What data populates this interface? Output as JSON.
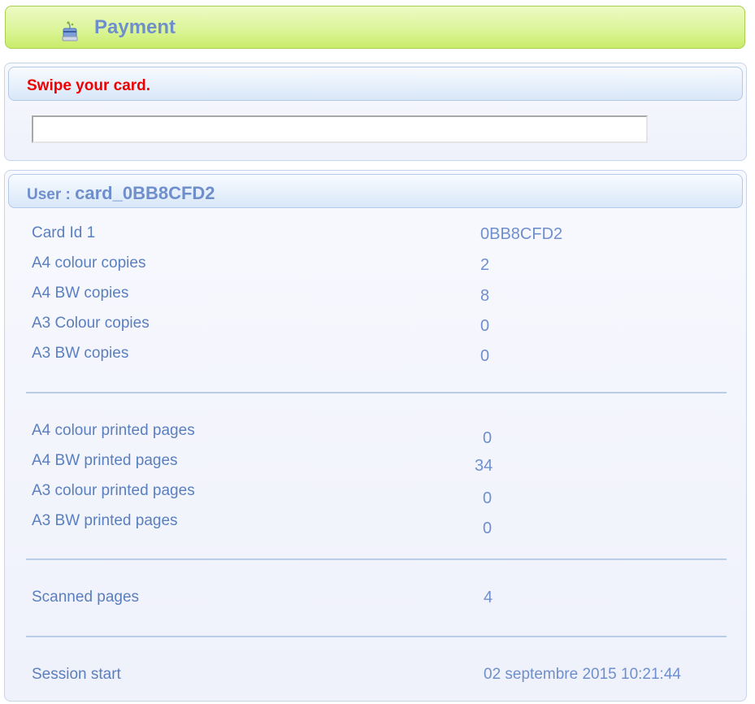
{
  "header": {
    "title": "Payment",
    "icon": "card-payment-icon"
  },
  "swipe": {
    "title": "Swipe your card.",
    "input_value": "",
    "input_placeholder": ""
  },
  "user": {
    "label": "User : ",
    "name": "card_0BB8CFD2"
  },
  "copies": [
    {
      "label": "Card Id 1",
      "value": "0BB8CFD2"
    },
    {
      "label": "A4 colour copies",
      "value": "2"
    },
    {
      "label": "A4 BW copies",
      "value": "8"
    },
    {
      "label": "A3 Colour copies",
      "value": "0"
    },
    {
      "label": "A3 BW copies",
      "value": "0"
    }
  ],
  "printed": [
    {
      "label": "A4 colour printed pages",
      "value": "0"
    },
    {
      "label": "A4 BW printed pages",
      "value": "34"
    },
    {
      "label": "A3 colour printed pages",
      "value": "0"
    },
    {
      "label": "A3 BW printed pages",
      "value": "0"
    }
  ],
  "scanned": {
    "label": "Scanned pages",
    "value": "4"
  },
  "session": {
    "label": "Session start",
    "value": "02 septembre 2015 10:21:44"
  },
  "colors": {
    "header_green": "#dcf59a",
    "title_blue": "#6f8fcc",
    "alert_red": "#ee0000"
  }
}
